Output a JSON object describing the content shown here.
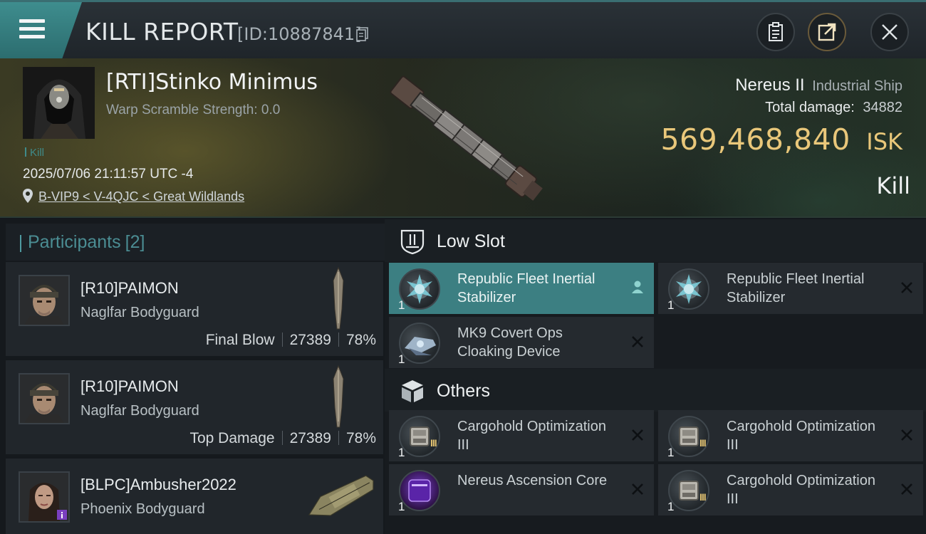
{
  "header": {
    "title": "KILL REPORT",
    "report_id": "[ID:10887841]"
  },
  "victim": {
    "name": "[RTI]Stinko Minimus",
    "warp_scramble": "Warp Scramble Strength: 0.0",
    "kill_tag": "Kill",
    "datetime": "2025/07/06 21:11:57 UTC -4",
    "location": "B-VIP9 < V-4QJC < Great Wildlands",
    "ship": "Nereus II",
    "ship_class": "Industrial Ship",
    "total_damage_label": "Total damage:",
    "total_damage": "34882",
    "isk_value": "569,468,840",
    "isk_unit": "ISK",
    "result": "Kill"
  },
  "participants": {
    "label": "Participants",
    "count": "[2]",
    "items": [
      {
        "name": "[R10]PAIMON",
        "ship": "Naglfar Bodyguard",
        "role": "Final Blow",
        "damage": "27389",
        "percent": "78%"
      },
      {
        "name": "[R10]PAIMON",
        "ship": "Naglfar Bodyguard",
        "role": "Top Damage",
        "damage": "27389",
        "percent": "78%"
      },
      {
        "name": "[BLPC]Ambusher2022",
        "ship": "Phoenix Bodyguard"
      }
    ]
  },
  "modules": {
    "low_slot_label": "Low Slot",
    "others_label": "Others",
    "low_slot": [
      {
        "name": "Republic Fleet Inertial Stabilizer",
        "qty": "1"
      },
      {
        "name": "Republic Fleet Inertial Stabilizer",
        "qty": "1"
      },
      {
        "name": "MK9 Covert Ops Cloaking Device",
        "qty": "1"
      }
    ],
    "others": [
      {
        "name": "Cargohold Optimization III",
        "qty": "1"
      },
      {
        "name": "Cargohold Optimization III",
        "qty": "1"
      },
      {
        "name": "Nereus Ascension Core",
        "qty": "1"
      },
      {
        "name": "Cargohold Optimization III",
        "qty": "1"
      }
    ]
  },
  "colors": {
    "accent_teal": "#3c7f82",
    "isk_gold": "#e9c77a"
  }
}
